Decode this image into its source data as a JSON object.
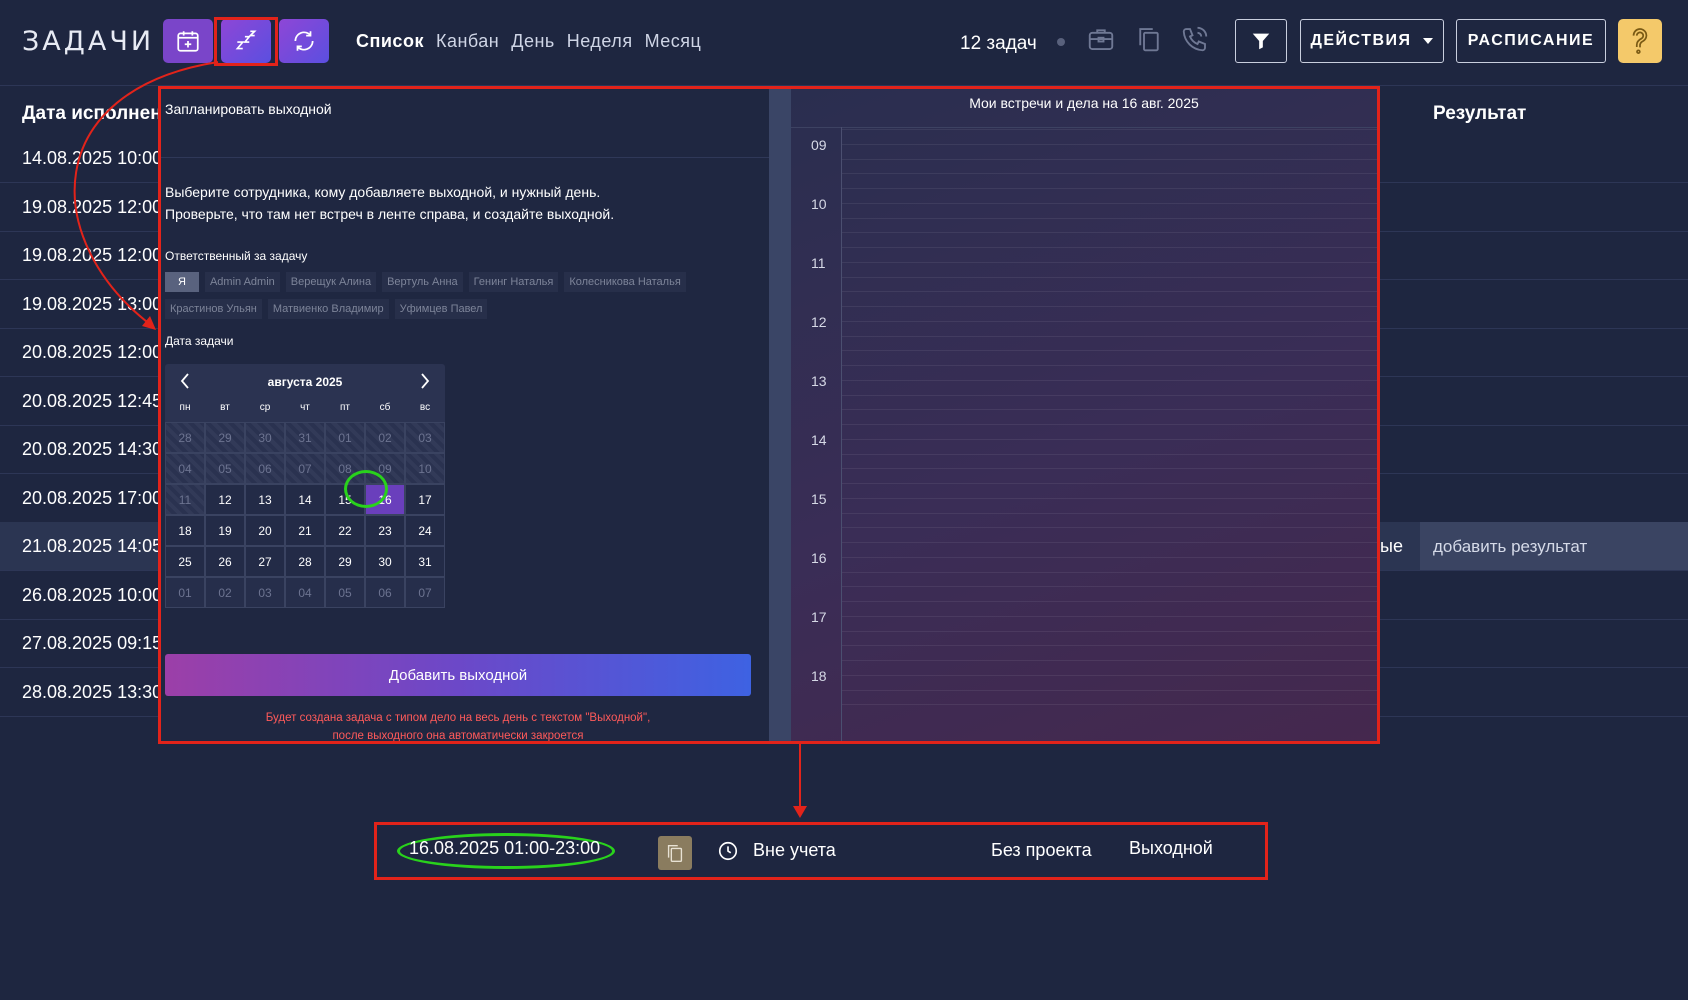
{
  "header": {
    "title": "ЗАДАЧИ",
    "views": [
      "Список",
      "Канбан",
      "День",
      "Неделя",
      "Месяц"
    ],
    "task_count": "12 задач",
    "actions_label": "ДЕЙСТВИЯ",
    "schedule_label": "РАСПИСАНИЕ",
    "icons": [
      "calendar-add-icon",
      "sleep-zzz-icon",
      "sync-icon",
      "briefcase-icon",
      "copy-icon",
      "phone-icon",
      "filter-icon",
      "question-icon"
    ]
  },
  "table": {
    "headers": {
      "date": "Дата исполнен",
      "result": "Результат"
    },
    "rows": [
      {
        "date": "14.08.2025 10:00"
      },
      {
        "date": "19.08.2025 12:00"
      },
      {
        "date": "19.08.2025 12:00"
      },
      {
        "date": "19.08.2025 13:00"
      },
      {
        "date": "20.08.2025 12:00"
      },
      {
        "date": "20.08.2025 12:45"
      },
      {
        "date": "20.08.2025 14:30"
      },
      {
        "date": "20.08.2025 17:00"
      },
      {
        "date": "21.08.2025 14:05",
        "result_tail": "ые",
        "result": "добавить результат"
      },
      {
        "date": "26.08.2025 10:00"
      },
      {
        "date": "27.08.2025 09:15"
      },
      {
        "date": "28.08.2025 13:30"
      }
    ]
  },
  "modal": {
    "title": "Запланировать выходной",
    "description": [
      "Выберите сотрудника, кому добавляете выходной, и нужный день.",
      "Проверьте, что там нет встреч в ленте справа, и создайте выходной."
    ],
    "assignee_label": "Ответственный за задачу",
    "assignees": [
      "Я",
      "Admin Admin",
      "Верещук Алина",
      "Вертуль Анна",
      "Генинг Наталья",
      "Колесникова Наталья",
      "Крастинов Ульян",
      "Матвиенко Владимир",
      "Уфимцев Павел"
    ],
    "selected_assignee": "Я",
    "date_label": "Дата задачи",
    "calendar": {
      "month_label": "августа 2025",
      "weekdays": [
        "пн",
        "вт",
        "ср",
        "чт",
        "пт",
        "сб",
        "вс"
      ],
      "days": [
        "28",
        "29",
        "30",
        "31",
        "01",
        "02",
        "03",
        "04",
        "05",
        "06",
        "07",
        "08",
        "09",
        "10",
        "11",
        "12",
        "13",
        "14",
        "15",
        "16",
        "17",
        "18",
        "19",
        "20",
        "21",
        "22",
        "23",
        "24",
        "25",
        "26",
        "27",
        "28",
        "29",
        "30",
        "31",
        "01",
        "02",
        "03",
        "04",
        "05",
        "06",
        "07"
      ],
      "disabled_count": 15,
      "selected_day": "16",
      "trailing_count": 7
    },
    "add_button": "Добавить выходной",
    "warning": [
      "Будет создана задача с типом дело на весь день с текстом \"Выходной\",",
      "после выходного она автоматически закроется"
    ]
  },
  "schedule": {
    "title": "Мои встречи и дела на 16 авг. 2025",
    "hours": [
      "09",
      "10",
      "11",
      "12",
      "13",
      "14",
      "15",
      "16",
      "17",
      "18"
    ]
  },
  "result_task": {
    "datetime": "16.08.2025 01:00-23:00",
    "status": "Вне учета",
    "project": "Без проекта",
    "text": "Выходной"
  },
  "colors": {
    "background": "#1e2640",
    "highlight_red": "#e2231a",
    "highlight_green": "#29d21c",
    "accent_purple": "#7a45c9",
    "help_yellow": "#f4c96a",
    "warning_text": "#ff5a5a"
  }
}
